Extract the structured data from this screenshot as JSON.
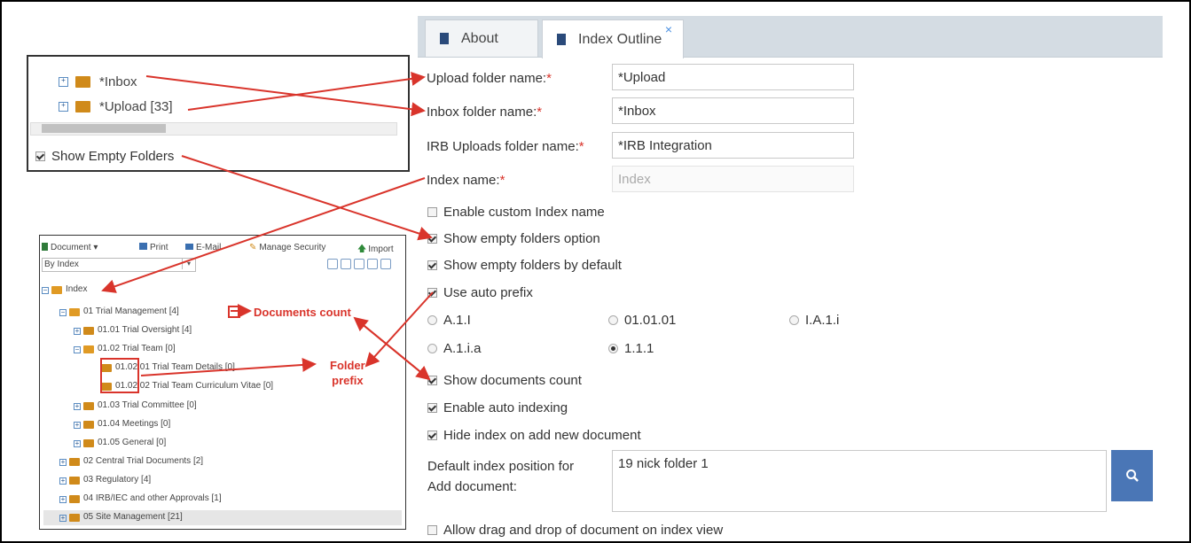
{
  "tabs": [
    {
      "label": "About"
    },
    {
      "label": "Index Outline",
      "close": "×"
    }
  ],
  "form": {
    "upload_label": "Upload folder name:",
    "upload_value": "*Upload",
    "inbox_label": "Inbox folder name:",
    "inbox_value": "*Inbox",
    "irb_label": "IRB Uploads folder name:",
    "irb_value": "*IRB Integration",
    "index_label": "Index name:",
    "index_placeholder": "Index",
    "required_mark": "*",
    "options": [
      {
        "label": "Enable custom Index name",
        "checked": false
      },
      {
        "label": "Show empty folders option",
        "checked": true
      },
      {
        "label": "Show empty folders by default",
        "checked": true
      },
      {
        "label": "Use auto prefix",
        "checked": true
      }
    ],
    "prefix_formats": [
      {
        "label": "A.1.I",
        "selected": false
      },
      {
        "label": "01.01.01",
        "selected": false
      },
      {
        "label": "I.A.1.i",
        "selected": false
      },
      {
        "label": "A.1.i.a",
        "selected": false
      },
      {
        "label": "1.1.1",
        "selected": true
      }
    ],
    "options2": [
      {
        "label": "Show documents count",
        "checked": true
      },
      {
        "label": "Enable auto indexing",
        "checked": true
      },
      {
        "label": "Hide index on add new document",
        "checked": true
      }
    ],
    "default_index_label_line1": "Default index position for",
    "default_index_label_line2": "Add document:",
    "default_index_value": "19 nick folder 1",
    "allow_drag_label": "Allow drag and drop of document on index view",
    "allow_drag_checked": false
  },
  "inset_folders": {
    "items": [
      {
        "label": "*Inbox"
      },
      {
        "label": "*Upload [33]"
      }
    ],
    "show_empty_label": "Show Empty Folders",
    "show_empty_checked": true
  },
  "inset_tree": {
    "toolbar": {
      "document": "Document",
      "print": "Print",
      "email": "E-Mail",
      "manage_security": "Manage Security",
      "import": "Import"
    },
    "view_select": "By Index",
    "root": "Index",
    "items": [
      {
        "label": "01 Trial Management [4]"
      },
      {
        "label": "01.01 Trial Oversight [4]"
      },
      {
        "label": "01.02 Trial Team [0]"
      },
      {
        "label": "01.02.01 Trial Team Details [0]"
      },
      {
        "label": "01.02.02 Trial Team Curriculum Vitae [0]"
      },
      {
        "label": "01.03 Trial Committee [0]"
      },
      {
        "label": "01.04 Meetings [0]"
      },
      {
        "label": "01.05 General [0]"
      },
      {
        "label": "02 Central Trial Documents [2]"
      },
      {
        "label": "03 Regulatory [4]"
      },
      {
        "label": "04 IRB/IEC and other Approvals [1]"
      },
      {
        "label": "05 Site Management [21]"
      }
    ]
  },
  "annotations": {
    "documents_count": "Documents count",
    "folder_prefix_line1": "Folder",
    "folder_prefix_line2": "prefix"
  },
  "colors": {
    "accent": "#4a76b6",
    "annotation": "#d9342b",
    "folder": "#d08a1a"
  }
}
